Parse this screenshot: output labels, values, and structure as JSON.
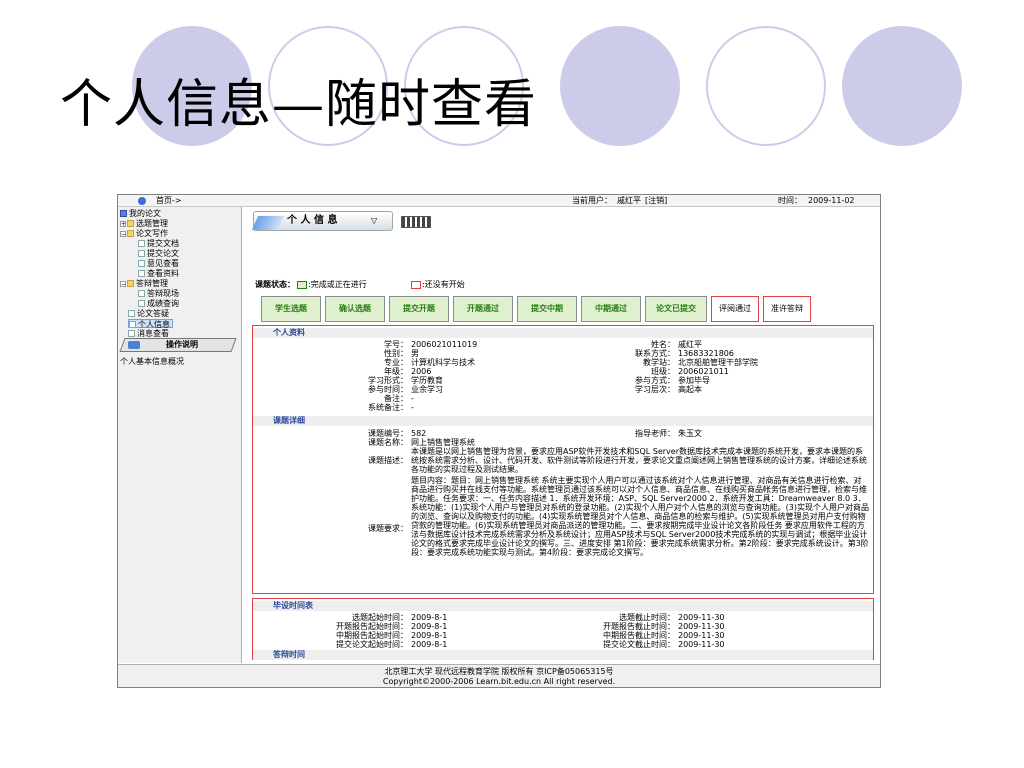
{
  "slide": {
    "title": "个人信息—随时查看"
  },
  "topbar": {
    "home": "首页->",
    "current_user_label": "当前用户：",
    "current_user": "戚红平",
    "logout": "[注销]",
    "time_label": "时间：",
    "time": "2009-11-02"
  },
  "sidebar": {
    "root": "我的论文",
    "items": [
      {
        "label": "选题管理"
      },
      {
        "label": "论文写作"
      },
      {
        "label": "提交文档"
      },
      {
        "label": "提交论文"
      },
      {
        "label": "意见查看"
      },
      {
        "label": "查看资料"
      },
      {
        "label": "答辩管理"
      },
      {
        "label": "答辩现场"
      },
      {
        "label": "成绩查询"
      },
      {
        "label": "论文答疑"
      },
      {
        "label": "个人信息"
      },
      {
        "label": "消息查看"
      }
    ],
    "tab": "操作说明",
    "desc": "个人基本信息概况"
  },
  "header": {
    "tab_label": "个 人 信 息"
  },
  "status": {
    "label": "课题状态：",
    "done_legend": ":完成或正在进行",
    "pending_legend": ":还没有开始",
    "stages": [
      {
        "label": "学生选题"
      },
      {
        "label": "确认选题"
      },
      {
        "label": "提交开题"
      },
      {
        "label": "开题通过"
      },
      {
        "label": "提交中期"
      },
      {
        "label": "中期通过"
      },
      {
        "label": "论文已提交"
      },
      {
        "label": "评阅通过"
      },
      {
        "label": "准许答辩"
      }
    ],
    "done_color": "#2a7d14",
    "pending_color": "#e04040"
  },
  "profile": {
    "title": "个人资料",
    "left": [
      {
        "label": "学号：",
        "value": "2006021011019"
      },
      {
        "label": "性别：",
        "value": "男"
      },
      {
        "label": "专业：",
        "value": "计算机科学与技术"
      },
      {
        "label": "年级：",
        "value": "2006"
      },
      {
        "label": "学习形式：",
        "value": "学历教育"
      },
      {
        "label": "参与时间：",
        "value": "业余学习"
      },
      {
        "label": "备注：",
        "value": "-"
      },
      {
        "label": "系统备注：",
        "value": "-"
      }
    ],
    "right": [
      {
        "label": "姓名：",
        "value": "戚红平"
      },
      {
        "label": "联系方式：",
        "value": "13683321806"
      },
      {
        "label": "教学站：",
        "value": "北京船舶管理干部学院"
      },
      {
        "label": "班级：",
        "value": "2006021011"
      },
      {
        "label": "参与方式：",
        "value": "参加毕导"
      },
      {
        "label": "学习层次：",
        "value": "高起本"
      }
    ]
  },
  "topic": {
    "title": "课题详细",
    "id_label": "课题编号：",
    "id": "582",
    "teacher_label": "指导老师：",
    "teacher": "朱玉文",
    "name_label": "课题名称：",
    "name": "网上销售管理系统",
    "desc_label": "课题描述：",
    "desc": "本课题是以网上销售管理为背景，要求应用ASP软件开发技术和SQL Server数据库技术完成本课题的系统开发，要求本课题的系统按系统需求分析、设计、代码开发、软件测试等阶段进行开发，要求论文重点阐述网上销售管理系统的设计方案，详细论述系统各功能的实现过程及测试结果。",
    "req_label": "课题要求：",
    "req": "题目内容：题目：网上销售管理系统 系统主要实现个人用户可以通过该系统对个人信息进行管理、对商品有关信息进行检索、对商品进行购买并在线支付等功能。系统管理员通过该系统可以对个人信息、商品信息、在线购买商品帐务信息进行管理，检索与维护功能。任务要求：一、任务内容描述 1．系统开发环境：ASP、SQL Server2000 2．系统开发工具：Dreamweaver 8.0 3．系统功能：(1)实现个人用户与管理员对系统的登录功能。(2)实现个人用户对个人信息的浏览与查询功能。(3)实现个人用户对商品的浏览、查询以及购物支付的功能。(4)实现系统管理员对个人信息、商品信息的检索与维护。(5)实现系统管理员对用户支付购物贷款的管理功能。(6)实现系统管理员对商品派送的管理功能。二、要求按期完成毕业设计论文各阶段任务 要求应用软件工程的方法与数据库设计技术完成系统需求分析及系统设计；应用ASP技术与SQL Server2000技术完成系统的实现与调试；根据毕业设计论文的格式要求完成毕业设计论文的撰写。三、进度安排 第1阶段：要求完成系统需求分析。第2阶段：要求完成系统设计。第3阶段：要求完成系统功能实现与测试。第4阶段：要求完成论文撰写。"
  },
  "schedule": {
    "title": "毕设时间表",
    "rows": [
      {
        "l_label": "选题起始时间：",
        "l_value": "2009-8-1",
        "r_label": "选题截止时间：",
        "r_value": "2009-11-30"
      },
      {
        "l_label": "开题报告起始时间：",
        "l_value": "2009-8-1",
        "r_label": "开题报告截止时间：",
        "r_value": "2009-11-30"
      },
      {
        "l_label": "中期报告起始时间：",
        "l_value": "2009-8-1",
        "r_label": "中期报告截止时间：",
        "r_value": "2009-11-30"
      },
      {
        "l_label": "提交论文起始时间：",
        "l_value": "2009-8-1",
        "r_label": "提交论文截止时间：",
        "r_value": "2009-11-30"
      }
    ],
    "defense_title": "答辩时间"
  },
  "footer": {
    "line1": "北京理工大学 现代远程教育学院 版权所有 京ICP备05065315号",
    "line2": "Copyright©2000-2006 Learn.bit.edu.cn All right reserved."
  }
}
